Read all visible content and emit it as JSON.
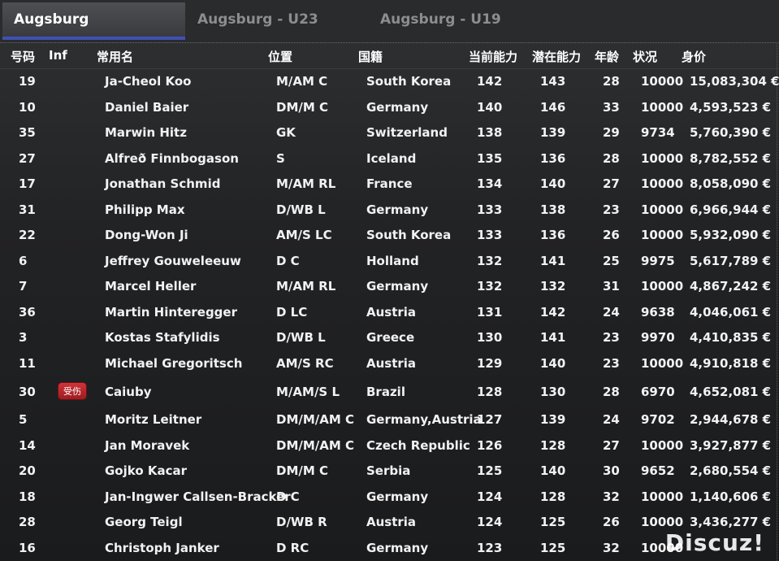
{
  "tabs": [
    {
      "label": "Augsburg",
      "active": true
    },
    {
      "label": "Augsburg - U23",
      "active": false
    },
    {
      "label": "Augsburg - U19",
      "active": false
    }
  ],
  "columns": {
    "num": "号码",
    "inf": "Inf",
    "name": "常用名",
    "pos": "位置",
    "nat": "国籍",
    "ca": "当前能力",
    "pa": "潜在能力",
    "age": "年龄",
    "cond": "状况",
    "val": "身价"
  },
  "players": [
    {
      "num": "19",
      "inf": "",
      "name": "Ja-Cheol Koo",
      "pos": "M/AM C",
      "nat": "South Korea",
      "ca": "142",
      "pa": "143",
      "age": "28",
      "cond": "10000",
      "val": "15,083,304 €"
    },
    {
      "num": "10",
      "inf": "",
      "name": "Daniel Baier",
      "pos": "DM/M C",
      "nat": "Germany",
      "ca": "140",
      "pa": "146",
      "age": "33",
      "cond": "10000",
      "val": "4,593,523 €"
    },
    {
      "num": "35",
      "inf": "",
      "name": "Marwin Hitz",
      "pos": "GK",
      "nat": "Switzerland",
      "ca": "138",
      "pa": "139",
      "age": "29",
      "cond": "9734",
      "val": "5,760,390 €"
    },
    {
      "num": "27",
      "inf": "",
      "name": "Alfreð Finnbogason",
      "pos": "S",
      "nat": "Iceland",
      "ca": "135",
      "pa": "136",
      "age": "28",
      "cond": "10000",
      "val": "8,782,552 €"
    },
    {
      "num": "17",
      "inf": "",
      "name": "Jonathan Schmid",
      "pos": "M/AM RL",
      "nat": "France",
      "ca": "134",
      "pa": "140",
      "age": "27",
      "cond": "10000",
      "val": "8,058,090 €"
    },
    {
      "num": "31",
      "inf": "",
      "name": "Philipp Max",
      "pos": "D/WB L",
      "nat": "Germany",
      "ca": "133",
      "pa": "138",
      "age": "23",
      "cond": "10000",
      "val": "6,966,944 €"
    },
    {
      "num": "22",
      "inf": "",
      "name": "Dong-Won Ji",
      "pos": "AM/S LC",
      "nat": "South Korea",
      "ca": "133",
      "pa": "136",
      "age": "26",
      "cond": "10000",
      "val": "5,932,090 €"
    },
    {
      "num": "6",
      "inf": "",
      "name": "Jeffrey Gouweleeuw",
      "pos": "D C",
      "nat": "Holland",
      "ca": "132",
      "pa": "141",
      "age": "25",
      "cond": "9975",
      "val": "5,617,789 €"
    },
    {
      "num": "7",
      "inf": "",
      "name": "Marcel Heller",
      "pos": "M/AM RL",
      "nat": "Germany",
      "ca": "132",
      "pa": "132",
      "age": "31",
      "cond": "10000",
      "val": "4,867,242 €"
    },
    {
      "num": "36",
      "inf": "",
      "name": "Martin Hinteregger",
      "pos": "D LC",
      "nat": "Austria",
      "ca": "131",
      "pa": "142",
      "age": "24",
      "cond": "9638",
      "val": "4,046,061 €"
    },
    {
      "num": "3",
      "inf": "",
      "name": "Kostas Stafylidis",
      "pos": "D/WB L",
      "nat": "Greece",
      "ca": "130",
      "pa": "141",
      "age": "23",
      "cond": "9970",
      "val": "4,410,835 €"
    },
    {
      "num": "11",
      "inf": "",
      "name": "Michael Gregoritsch",
      "pos": "AM/S RC",
      "nat": "Austria",
      "ca": "129",
      "pa": "140",
      "age": "23",
      "cond": "10000",
      "val": "4,910,818 €"
    },
    {
      "num": "30",
      "inf": "受伤",
      "name": "Caiuby",
      "pos": "M/AM/S L",
      "nat": "Brazil",
      "ca": "128",
      "pa": "130",
      "age": "28",
      "cond": "6970",
      "val": "4,652,081 €"
    },
    {
      "num": "5",
      "inf": "",
      "name": "Moritz Leitner",
      "pos": "DM/M/AM C",
      "nat": "Germany,Austria",
      "ca": "127",
      "pa": "139",
      "age": "24",
      "cond": "9702",
      "val": "2,944,678 €"
    },
    {
      "num": "14",
      "inf": "",
      "name": "Jan Moravek",
      "pos": "DM/M/AM C",
      "nat": "Czech Republic",
      "ca": "126",
      "pa": "128",
      "age": "27",
      "cond": "10000",
      "val": "3,927,877 €"
    },
    {
      "num": "20",
      "inf": "",
      "name": "Gojko Kacar",
      "pos": "DM/M C",
      "nat": "Serbia",
      "ca": "125",
      "pa": "140",
      "age": "30",
      "cond": "9652",
      "val": "2,680,554 €"
    },
    {
      "num": "18",
      "inf": "",
      "name": "Jan-Ingwer Callsen-Bracker",
      "pos": "D C",
      "nat": "Germany",
      "ca": "124",
      "pa": "128",
      "age": "32",
      "cond": "10000",
      "val": "1,140,606 €"
    },
    {
      "num": "28",
      "inf": "",
      "name": "Georg Teigl",
      "pos": "D/WB R",
      "nat": "Austria",
      "ca": "124",
      "pa": "125",
      "age": "26",
      "cond": "10000",
      "val": "3,436,277 €"
    },
    {
      "num": "16",
      "inf": "",
      "name": "Christoph Janker",
      "pos": "D RC",
      "nat": "Germany",
      "ca": "123",
      "pa": "125",
      "age": "32",
      "cond": "10000",
      "val": ""
    }
  ],
  "watermark": "Discuz!"
}
